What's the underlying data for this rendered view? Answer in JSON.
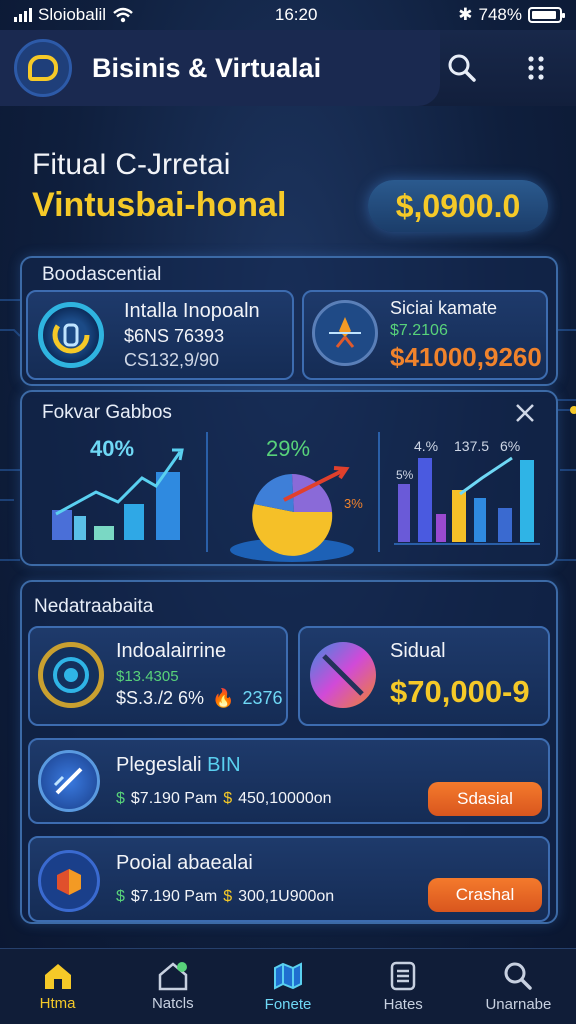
{
  "status": {
    "carrier": "Sloiobalil",
    "time": "16:20",
    "battery": "748%"
  },
  "app": {
    "title": "Bisinis  Virtualai",
    "title_mark": "&"
  },
  "hero": {
    "line1": "FituaI C-Jrretai",
    "line2": "Vintusbai-honal",
    "amount": "$,0900.0"
  },
  "panel1": {
    "title": "Boodascential",
    "card_left": {
      "name": "Intalla Inopoaln",
      "value1": "$6NS 76393",
      "value2": "CS132,9/90"
    },
    "card_right": {
      "name": "Siciai kamate",
      "value1": "$7.2106",
      "value2": "$41000,9260"
    }
  },
  "panel2": {
    "title": "Fokvar Gabbos",
    "chart1_label": "40%",
    "chart2_label": "29%",
    "chart2_side": "3%",
    "chart3_labels": [
      "4.%",
      "137.5",
      "6%"
    ],
    "chart3_side": "5%"
  },
  "panel3": {
    "title": "Nedatraabaita",
    "card_left": {
      "name": "Indoalairrine",
      "value1": "$13.4305",
      "value2": "$S.3./2 6%",
      "value3": "2376"
    },
    "card_right": {
      "name": "Sidual",
      "value1": "$70,000-9"
    },
    "row1": {
      "name": "Plegeslali",
      "name_accent": "BIN",
      "detail_a": "$",
      "detail_b": "$7.190 Pam",
      "detail_c": "$",
      "detail_d": "450,10000on",
      "button": "Sdasial"
    },
    "row2": {
      "name": "Pooial abaealai",
      "detail_a": "$",
      "detail_b": "$7.190 Pam",
      "detail_c": "$",
      "detail_d": "300,1U900on",
      "button": "Crashal"
    }
  },
  "nav": {
    "items": [
      {
        "label": "Htma",
        "icon": "home-icon"
      },
      {
        "label": "Natcls",
        "icon": "house-notification-icon"
      },
      {
        "label": "Fonete",
        "icon": "map-icon"
      },
      {
        "label": "Hates",
        "icon": "document-icon"
      },
      {
        "label": "Unarnabe",
        "icon": "search-icon"
      }
    ]
  },
  "colors": {
    "accent": "#f5c928",
    "green": "#58d27a",
    "orange": "#f0832c",
    "panel_border": "#3c6aa6",
    "background": "#0f1f3d"
  }
}
